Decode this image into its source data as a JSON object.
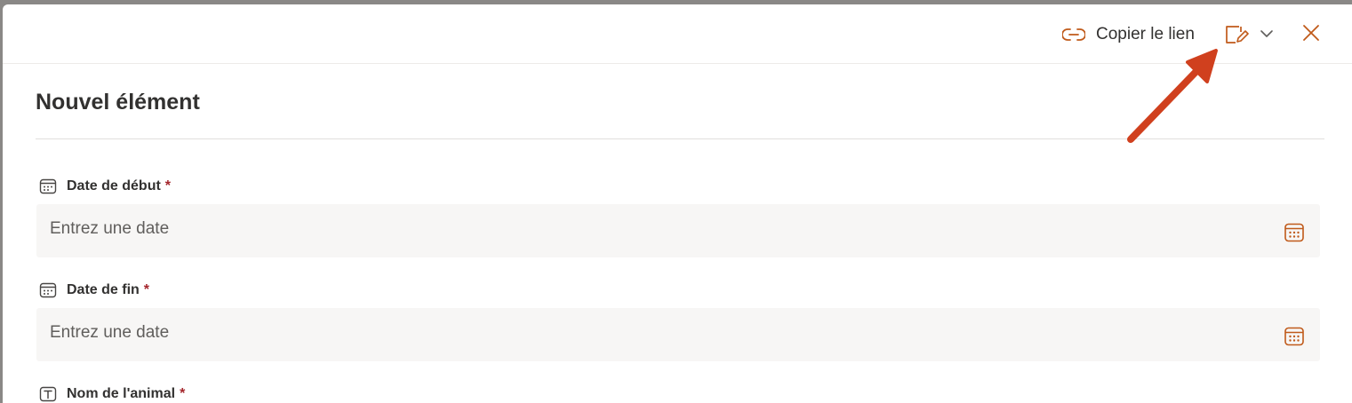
{
  "header": {
    "copy_link_label": "Copier le lien",
    "accent_color": "#c05a1a"
  },
  "form": {
    "title": "Nouvel élément",
    "fields": [
      {
        "label": "Date de début",
        "required_mark": "*",
        "placeholder": "Entrez une date",
        "icon": "calendar-field-icon"
      },
      {
        "label": "Date de fin",
        "required_mark": "*",
        "placeholder": "Entrez une date",
        "icon": "calendar-field-icon"
      },
      {
        "label": "Nom de l'animal",
        "required_mark": "*",
        "icon": "text-field-icon"
      }
    ]
  },
  "annotation": {
    "arrow_color": "#d0401e"
  }
}
